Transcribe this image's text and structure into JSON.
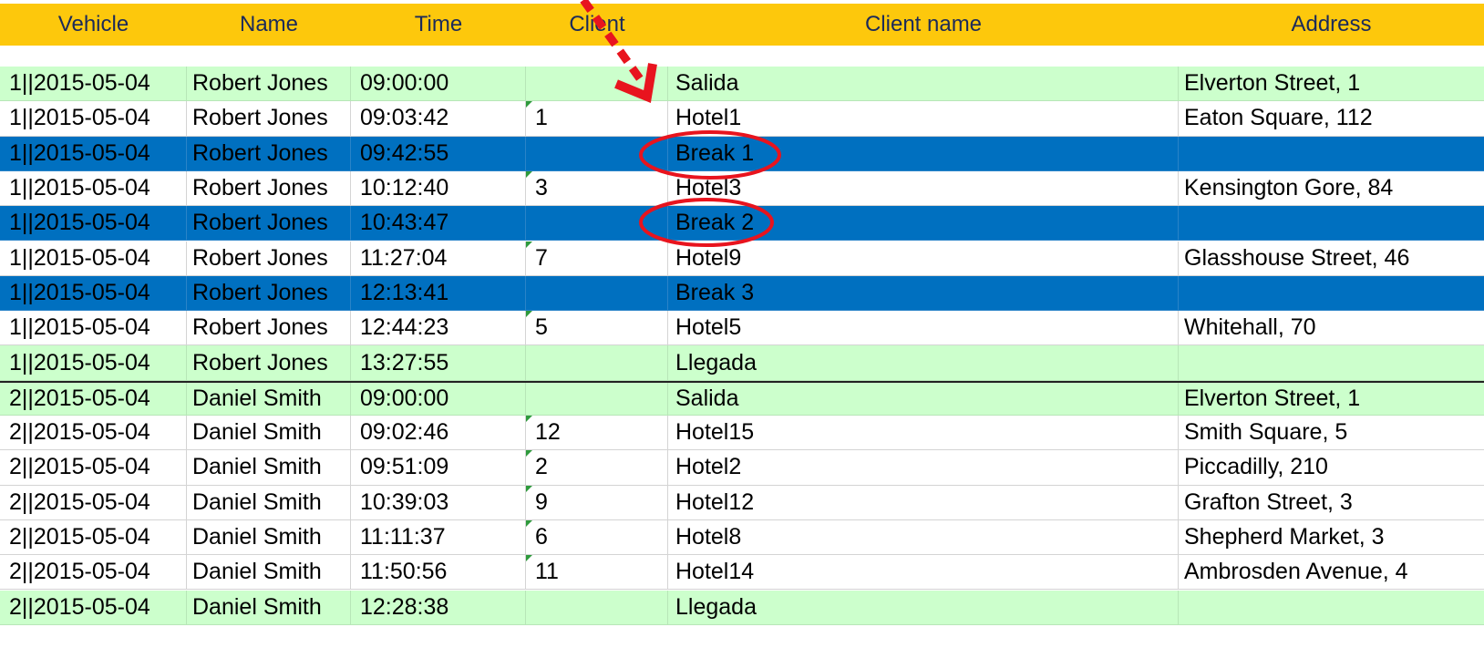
{
  "header": {
    "vehicle": "Vehicle",
    "name": "Name",
    "time": "Time",
    "client": "Client",
    "client_name": "Client name",
    "address": "Address"
  },
  "rows": [
    {
      "vehicle": "1||2015-05-04",
      "name": "Robert Jones",
      "time": "09:00:00",
      "client": "",
      "client_name": "Salida",
      "address": "Elverton Street, 1",
      "style": "green"
    },
    {
      "vehicle": "1||2015-05-04",
      "name": "Robert Jones",
      "time": "09:03:42",
      "client": "1",
      "client_name": "Hotel1",
      "address": "Eaton Square, 112",
      "style": "white"
    },
    {
      "vehicle": "1||2015-05-04",
      "name": "Robert Jones",
      "time": "09:42:55",
      "client": "",
      "client_name": "Break 1",
      "address": "",
      "style": "blue"
    },
    {
      "vehicle": "1||2015-05-04",
      "name": "Robert Jones",
      "time": "10:12:40",
      "client": "3",
      "client_name": "Hotel3",
      "address": "Kensington Gore, 84",
      "style": "white"
    },
    {
      "vehicle": "1||2015-05-04",
      "name": "Robert Jones",
      "time": "10:43:47",
      "client": "",
      "client_name": "Break 2",
      "address": "",
      "style": "blue"
    },
    {
      "vehicle": "1||2015-05-04",
      "name": "Robert Jones",
      "time": "11:27:04",
      "client": "7",
      "client_name": "Hotel9",
      "address": "Glasshouse Street, 46",
      "style": "white"
    },
    {
      "vehicle": "1||2015-05-04",
      "name": "Robert Jones",
      "time": "12:13:41",
      "client": "",
      "client_name": "Break 3",
      "address": "",
      "style": "blue"
    },
    {
      "vehicle": "1||2015-05-04",
      "name": "Robert Jones",
      "time": "12:44:23",
      "client": "5",
      "client_name": "Hotel5",
      "address": "Whitehall, 70",
      "style": "white"
    },
    {
      "vehicle": "1||2015-05-04",
      "name": "Robert Jones",
      "time": "13:27:55",
      "client": "",
      "client_name": "Llegada",
      "address": "",
      "style": "green"
    },
    {
      "vehicle": "2||2015-05-04",
      "name": "Daniel Smith",
      "time": "09:00:00",
      "client": "",
      "client_name": "Salida",
      "address": "Elverton Street, 1",
      "style": "green"
    },
    {
      "vehicle": "2||2015-05-04",
      "name": "Daniel Smith",
      "time": "09:02:46",
      "client": "12",
      "client_name": "Hotel15",
      "address": "Smith Square, 5",
      "style": "white"
    },
    {
      "vehicle": "2||2015-05-04",
      "name": "Daniel Smith",
      "time": "09:51:09",
      "client": "2",
      "client_name": "Hotel2",
      "address": "Piccadilly, 210",
      "style": "white"
    },
    {
      "vehicle": "2||2015-05-04",
      "name": "Daniel Smith",
      "time": "10:39:03",
      "client": "9",
      "client_name": "Hotel12",
      "address": "Grafton Street, 3",
      "style": "white"
    },
    {
      "vehicle": "2||2015-05-04",
      "name": "Daniel Smith",
      "time": "11:11:37",
      "client": "6",
      "client_name": "Hotel8",
      "address": "Shepherd Market, 3",
      "style": "white"
    },
    {
      "vehicle": "2||2015-05-04",
      "name": "Daniel Smith",
      "time": "11:50:56",
      "client": "11",
      "client_name": "Hotel14",
      "address": "Ambrosden Avenue, 4",
      "style": "white"
    },
    {
      "vehicle": "2||2015-05-04",
      "name": "Daniel Smith",
      "time": "12:28:38",
      "client": "",
      "client_name": "Llegada",
      "address": "",
      "style": "green"
    }
  ],
  "colors": {
    "header_bg": "#fdc80c",
    "header_text": "#1b2a5a",
    "depot_row": "#ccffcc",
    "break_row": "#0070c0",
    "annotation": "#e8141e"
  },
  "annotations": {
    "circled_rows": [
      2,
      4
    ],
    "arrow_target": "client-name-column"
  }
}
